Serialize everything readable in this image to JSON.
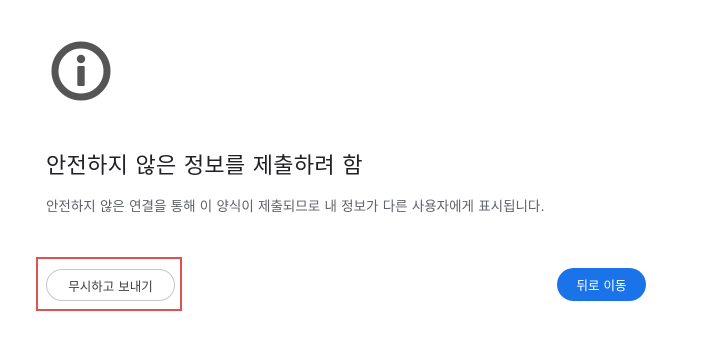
{
  "icon": {
    "name": "info-icon",
    "color": "#555555"
  },
  "warning": {
    "title": "안전하지 않은 정보를 제출하려 함",
    "description": "안전하지 않은 연결을 통해 이 양식이 제출되므로 내 정보가 다른 사용자에게 표시됩니다."
  },
  "actions": {
    "proceed_label": "무시하고 보내기",
    "back_label": "뒤로 이동"
  },
  "colors": {
    "primary": "#1a73e8",
    "highlight": "#e05252"
  }
}
